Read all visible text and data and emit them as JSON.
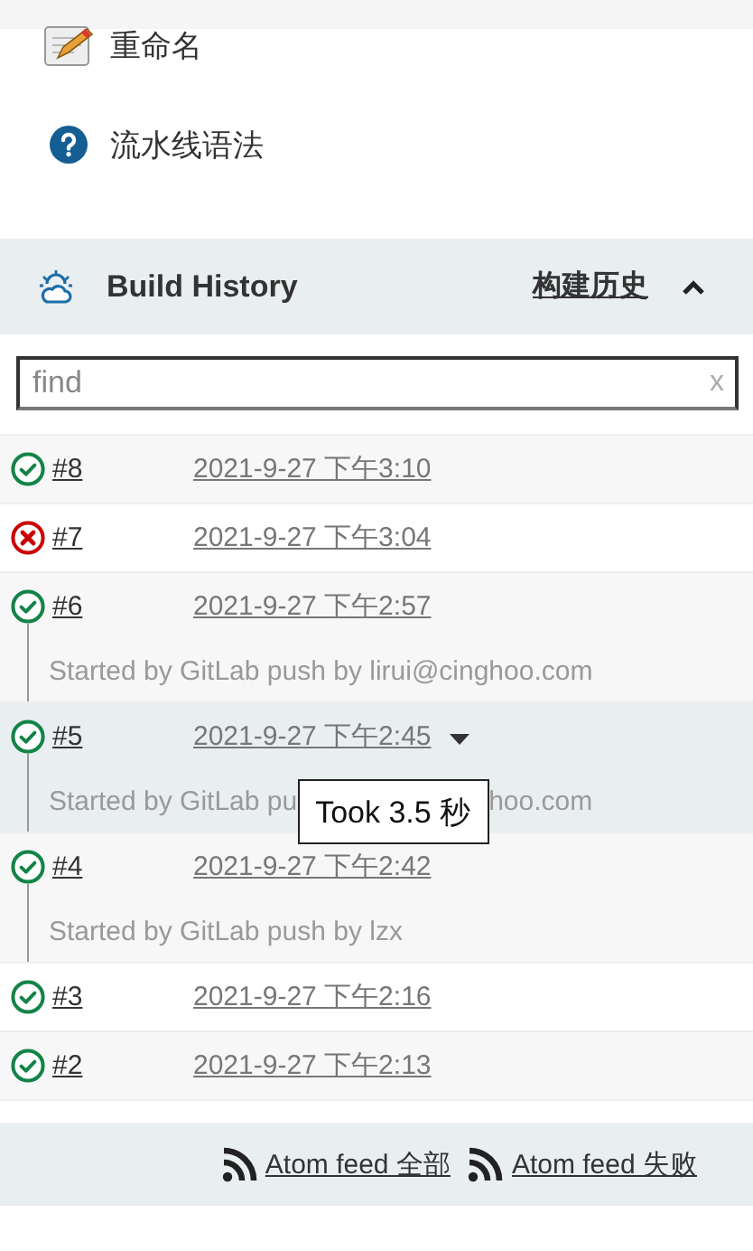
{
  "tasks": [
    {
      "kind": "rename",
      "label": "重命名"
    },
    {
      "kind": "help",
      "label": "流水线语法"
    }
  ],
  "build_history": {
    "title": "Build History",
    "trend_link": "构建历史",
    "expanded": true,
    "search": {
      "placeholder": "find",
      "clear": "x"
    },
    "builds": [
      {
        "number": "#8",
        "failed": false,
        "time": "2021-9-27 下午3:10",
        "selected": false
      },
      {
        "number": "#7",
        "failed": true,
        "time": "2021-9-27 下午3:04",
        "selected": false
      },
      {
        "number": "#6",
        "failed": false,
        "time": "2021-9-27 下午2:57",
        "selected": false,
        "description": "Started by GitLab push by lirui@cinghoo.com"
      },
      {
        "number": "#5",
        "failed": false,
        "time": "2021-9-27 下午2:45",
        "selected": true,
        "description_parts": [
          "Started by GitLab pu",
          "hoo.com"
        ],
        "tooltip": "Took 3.5 秒"
      },
      {
        "number": "#4",
        "failed": false,
        "time": "2021-9-27 下午2:42",
        "selected": false,
        "description": "Started by GitLab push by lzx"
      },
      {
        "number": "#3",
        "failed": false,
        "time": "2021-9-27 下午2:16",
        "selected": false
      },
      {
        "number": "#2",
        "failed": false,
        "time": "2021-9-27 下午2:13",
        "selected": false
      }
    ],
    "feeds": [
      {
        "label": "Atom feed 全部"
      },
      {
        "label": "Atom feed 失败"
      }
    ]
  }
}
